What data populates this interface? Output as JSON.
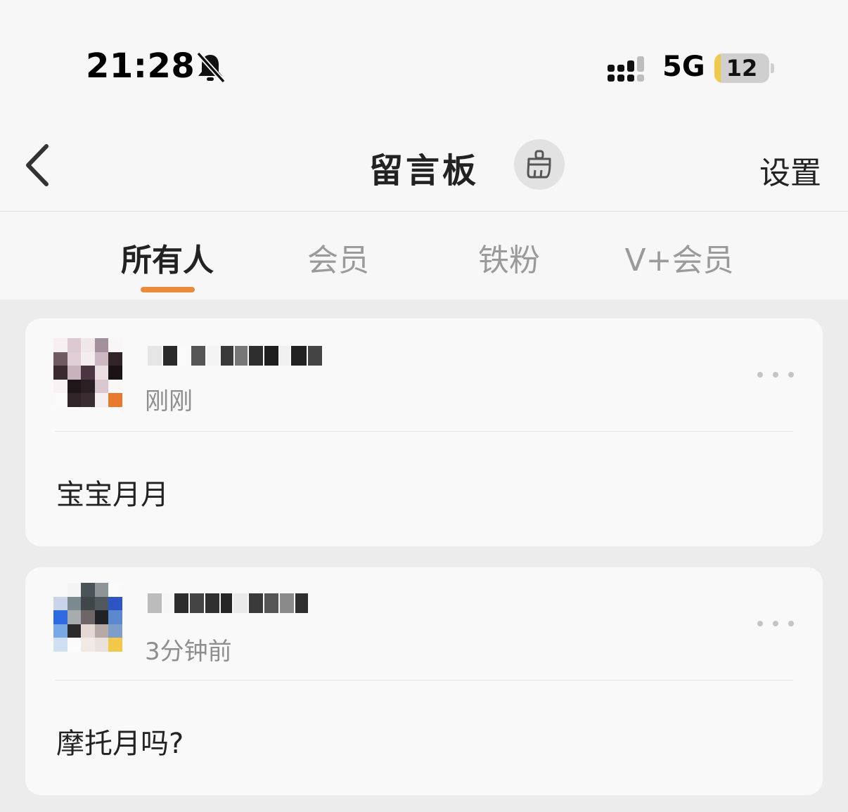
{
  "status_bar": {
    "time": "21:28",
    "network": "5G",
    "battery_level": "12",
    "battery_fraction": 0.12
  },
  "nav": {
    "title": "留言板",
    "settings_label": "设置"
  },
  "tabs": [
    {
      "label": "所有人",
      "active": true
    },
    {
      "label": "会员",
      "active": false
    },
    {
      "label": "铁粉",
      "active": false
    },
    {
      "label": "V+会员",
      "active": false
    }
  ],
  "messages": [
    {
      "time": "刚刚",
      "text": "宝宝月月"
    },
    {
      "time": "3分钟前",
      "text": "摩托月吗?"
    }
  ],
  "colors": {
    "accent": "#ea8a3b",
    "background": "#ececec",
    "card": "#f9f9f9"
  }
}
